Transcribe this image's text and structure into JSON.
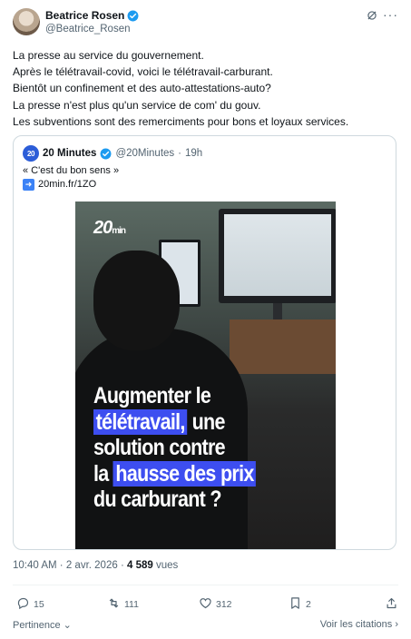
{
  "author": {
    "display_name": "Beatrice Rosen",
    "handle": "@Beatrice_Rosen"
  },
  "tweet": {
    "lines": [
      "La presse au service du gouvernement.",
      "Après le télétravail-covid, voici le télétravail-carburant.",
      "Bientôt un confinement et des auto-attestations-auto?",
      "La presse n'est plus qu'un service de com' du gouv.",
      "Les subventions sont des remerciments pour bons et loyaux services."
    ]
  },
  "quoted": {
    "logo_text": "20",
    "display_name": "20 Minutes",
    "handle": "@20Minutes",
    "separator": "·",
    "age": "19h",
    "text": "« C'est du bon sens »",
    "link": "20min.fr/1ZO",
    "media": {
      "brand": "20",
      "brand_suffix": "min",
      "headline_lines": [
        {
          "before": "Augmenter le",
          "highlight": "",
          "after": ""
        },
        {
          "before": "",
          "highlight": "télétravail,",
          "after": " une"
        },
        {
          "before": "solution contre",
          "highlight": "",
          "after": ""
        },
        {
          "before": "la ",
          "highlight": "hausse des prix",
          "after": ""
        },
        {
          "before": "du carburant ?",
          "highlight": "",
          "after": ""
        }
      ]
    }
  },
  "meta": {
    "time": "10:40 AM",
    "separator": "·",
    "date": "2 avr. 2026",
    "separator2": "·",
    "views_count": "4 589",
    "views_label": "vues"
  },
  "actions": {
    "replies": "15",
    "retweets": "111",
    "likes": "312",
    "bookmarks": "2"
  },
  "footer": {
    "left": "Pertinence",
    "right": "Voir les citations"
  },
  "colors": {
    "verified": "#1d9bf0",
    "highlight": "#3d4ef0",
    "muted": "#536471"
  }
}
